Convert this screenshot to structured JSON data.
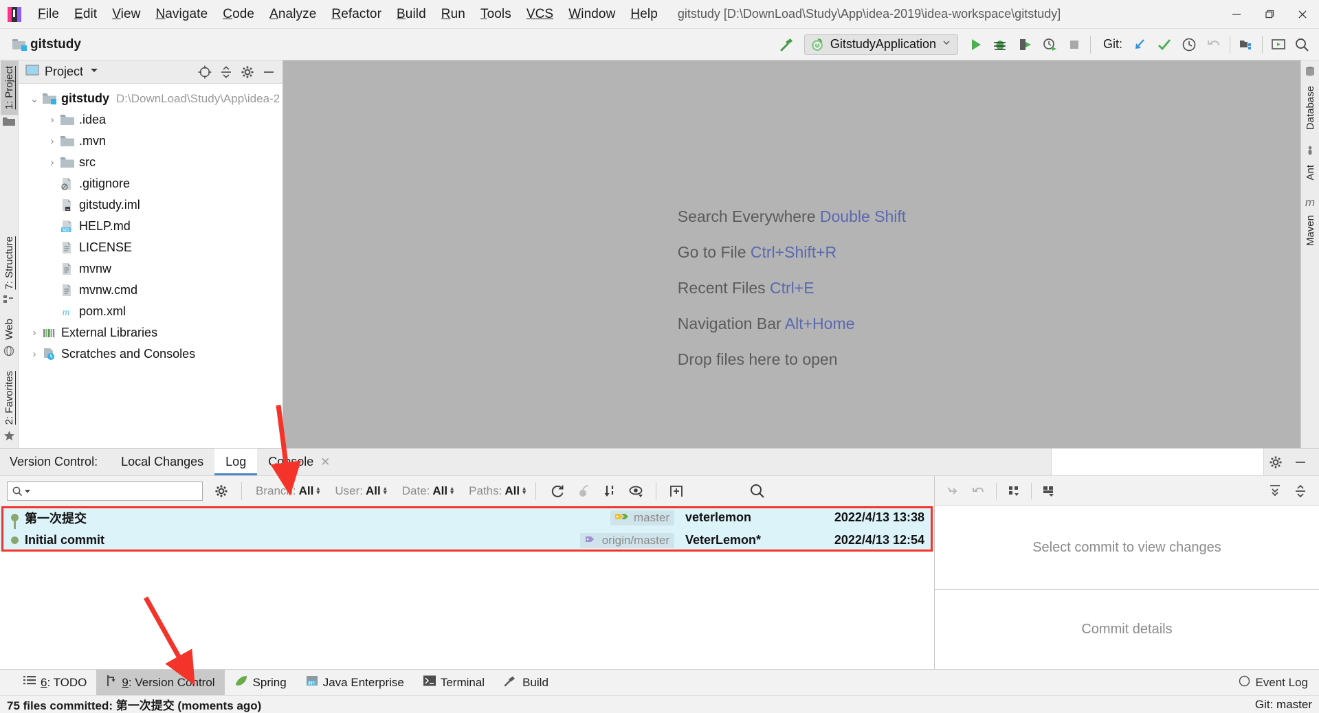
{
  "window": {
    "title": "gitstudy [D:\\DownLoad\\Study\\App\\idea-2019\\idea-workspace\\gitstudy]",
    "minimize": "—",
    "maximize": "❐",
    "close": "✕"
  },
  "menu": [
    {
      "mnemonic": "F",
      "rest": "ile"
    },
    {
      "mnemonic": "E",
      "rest": "dit"
    },
    {
      "mnemonic": "V",
      "rest": "iew"
    },
    {
      "mnemonic": "N",
      "rest": "avigate"
    },
    {
      "mnemonic": "C",
      "rest": "ode"
    },
    {
      "mnemonic": "A",
      "rest": "nalyze"
    },
    {
      "mnemonic": "R",
      "rest": "efactor"
    },
    {
      "mnemonic": "B",
      "rest": "uild"
    },
    {
      "mnemonic": "R",
      "rest": "un"
    },
    {
      "mnemonic": "T",
      "rest": "ools"
    },
    {
      "mnemonic": "VCS",
      "rest": ""
    },
    {
      "mnemonic": "W",
      "rest": "indow"
    },
    {
      "mnemonic": "H",
      "rest": "elp"
    }
  ],
  "toolbar": {
    "breadcrumb": "gitstudy",
    "build_icon": "hammer-icon",
    "run_config": "GitstudyApplication",
    "run_label": "run-button",
    "debug_label": "debug-button",
    "coverage_label": "run-with-coverage-button",
    "profile_label": "profile-button",
    "stop_label": "stop-button",
    "git_label": "Git:",
    "git_update": "update-project-icon",
    "git_commit": "commit-icon",
    "git_history": "history-icon",
    "git_rollback": "rollback-icon",
    "project_structure": "project-structure-icon",
    "run_anything": "run-anything-icon",
    "search": "search-everywhere-icon"
  },
  "left_stripe": [
    {
      "label": "1: Project",
      "mnemonic": "1",
      "icon": "project-folder-icon",
      "active": true
    },
    {
      "label": "7: Structure",
      "mnemonic": "7",
      "icon": "structure-icon",
      "active": false
    },
    {
      "label": "Web",
      "mnemonic": "",
      "icon": "web-icon",
      "active": false
    },
    {
      "label": "2: Favorites",
      "mnemonic": "2",
      "icon": "star-icon",
      "active": false
    }
  ],
  "right_stripe": [
    {
      "label": "Database",
      "icon": "database-icon"
    },
    {
      "label": "Ant",
      "icon": "ant-icon"
    },
    {
      "label": "Maven",
      "icon": "maven-icon"
    }
  ],
  "project_panel": {
    "title": "Project",
    "chevron": "▾",
    "actions": [
      "locate-icon",
      "collapse-all-icon",
      "settings-gear-icon",
      "hide-icon"
    ],
    "tree": [
      {
        "depth": 0,
        "arrow": "⌄",
        "icon": "module-folder-icon",
        "label": "gitstudy",
        "bold": true,
        "sub": "D:\\DownLoad\\Study\\App\\idea-2"
      },
      {
        "depth": 1,
        "arrow": "›",
        "icon": "folder-icon",
        "label": ".idea",
        "bold": false,
        "sub": ""
      },
      {
        "depth": 1,
        "arrow": "›",
        "icon": "folder-icon",
        "label": ".mvn",
        "bold": false,
        "sub": ""
      },
      {
        "depth": 1,
        "arrow": "›",
        "icon": "folder-icon",
        "label": "src",
        "bold": false,
        "sub": ""
      },
      {
        "depth": 1,
        "arrow": "",
        "icon": "gitignore-file-icon",
        "label": ".gitignore",
        "bold": false,
        "sub": ""
      },
      {
        "depth": 1,
        "arrow": "",
        "icon": "iml-file-icon",
        "label": "gitstudy.iml",
        "bold": false,
        "sub": ""
      },
      {
        "depth": 1,
        "arrow": "",
        "icon": "markdown-file-icon",
        "label": "HELP.md",
        "bold": false,
        "sub": ""
      },
      {
        "depth": 1,
        "arrow": "",
        "icon": "text-file-icon",
        "label": "LICENSE",
        "bold": false,
        "sub": ""
      },
      {
        "depth": 1,
        "arrow": "",
        "icon": "text-file-icon",
        "label": "mvnw",
        "bold": false,
        "sub": ""
      },
      {
        "depth": 1,
        "arrow": "",
        "icon": "text-file-icon",
        "label": "mvnw.cmd",
        "bold": false,
        "sub": ""
      },
      {
        "depth": 1,
        "arrow": "",
        "icon": "maven-pom-icon",
        "label": "pom.xml",
        "bold": false,
        "sub": ""
      },
      {
        "depth": 0,
        "arrow": "›",
        "icon": "external-libraries-icon",
        "label": "External Libraries",
        "bold": false,
        "sub": ""
      },
      {
        "depth": 0,
        "arrow": "›",
        "icon": "scratches-icon",
        "label": "Scratches and Consoles",
        "bold": false,
        "sub": ""
      }
    ]
  },
  "editor": {
    "hints": [
      {
        "action": "Search Everywhere",
        "shortcut": "Double Shift"
      },
      {
        "action": "Go to File",
        "shortcut": "Ctrl+Shift+R"
      },
      {
        "action": "Recent Files",
        "shortcut": "Ctrl+E"
      },
      {
        "action": "Navigation Bar",
        "shortcut": "Alt+Home"
      },
      {
        "action": "Drop files here to open",
        "shortcut": ""
      }
    ]
  },
  "vcs": {
    "title": "Version Control:",
    "tabs": [
      {
        "label": "Local Changes",
        "active": false,
        "closable": false
      },
      {
        "label": "Log",
        "active": true,
        "closable": false
      },
      {
        "label": "Console",
        "active": false,
        "closable": true
      }
    ],
    "close_glyph": "✕",
    "panel_actions": [
      "settings-gear-icon",
      "hide-panel-icon"
    ],
    "log_toolbar": {
      "search_placeholder": "",
      "search_icon": "magnifier-icon",
      "gear_icon": "settings-gear-icon",
      "filters": [
        {
          "name": "Branch:",
          "value": "All"
        },
        {
          "name": "User:",
          "value": "All"
        },
        {
          "name": "Date:",
          "value": "All"
        },
        {
          "name": "Paths:",
          "value": "All"
        }
      ],
      "buttons": [
        "refresh-icon",
        "cherry-pick-icon",
        "go-to-hash-icon",
        "show-details-icon",
        "new-tab-icon",
        "search-icon"
      ]
    },
    "commits": [
      {
        "subject": "第一次提交",
        "ref": "master",
        "ref_icon": "branch-label-icon",
        "author": "veterlemon",
        "date": "2022/4/13 13:38"
      },
      {
        "subject": "Initial commit",
        "ref": "origin/master",
        "ref_icon": "remote-branch-icon",
        "author": "VeterLemon*",
        "date": "2022/4/13 12:54"
      }
    ],
    "right_toolbar": [
      "collapse-to-selection-icon",
      "revert-icon",
      "group-by-directory-icon",
      "group-by-module-icon",
      "expand-all-icon",
      "collapse-all-icon"
    ],
    "changes_placeholder": "Select commit to view changes",
    "details_placeholder": "Commit details"
  },
  "bottom_tool_buttons": [
    {
      "label": "6: TODO",
      "mnemonic": "6",
      "icon": "todo-icon",
      "active": false
    },
    {
      "label": "9: Version Control",
      "mnemonic": "9",
      "icon": "vcs-branch-icon",
      "active": true
    },
    {
      "label": "Spring",
      "mnemonic": "",
      "icon": "spring-leaf-icon",
      "active": false
    },
    {
      "label": "Java Enterprise",
      "mnemonic": "",
      "icon": "java-enterprise-icon",
      "active": false
    },
    {
      "label": "Terminal",
      "mnemonic": "",
      "icon": "terminal-icon",
      "active": false
    },
    {
      "label": "Build",
      "mnemonic": "",
      "icon": "hammer-icon",
      "active": false
    }
  ],
  "event_log": {
    "label": "Event Log",
    "icon": "balloon-icon"
  },
  "statusbar": {
    "message": "75 files committed: 第一次提交 (moments ago)",
    "right": "Git: master"
  },
  "colors": {
    "accent_blue": "#4a88c7",
    "link_blue": "#5a68b0",
    "selection": "#ddf3fa",
    "annotation_red": "#f4342a",
    "green_run": "#4caf50",
    "graph_green": "#8aa86d"
  }
}
